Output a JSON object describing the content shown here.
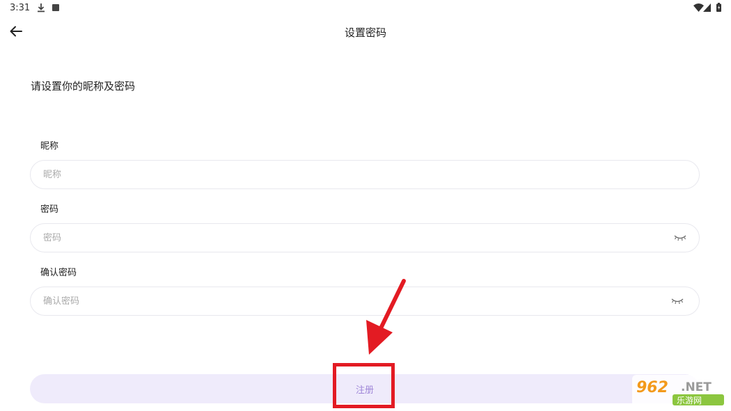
{
  "status_bar": {
    "time": "3:31",
    "icons": [
      "download-icon",
      "app-notification-icon",
      "wifi-icon",
      "signal-icon",
      "battery-icon"
    ]
  },
  "app_bar": {
    "title": "设置密码",
    "back_icon": "arrow-left-icon"
  },
  "intro": "请设置你的昵称及密码",
  "form": {
    "nickname": {
      "label": "昵称",
      "placeholder": "昵称",
      "value": ""
    },
    "password": {
      "label": "密码",
      "placeholder": "密码",
      "value": "",
      "toggle_icon": "eye-closed-icon"
    },
    "confirm_password": {
      "label": "确认密码",
      "placeholder": "确认密码",
      "value": "",
      "toggle_icon": "eye-closed-icon"
    },
    "submit_label": "注册"
  },
  "colors": {
    "button_bg": "#efebfb",
    "button_text": "#9f86d8",
    "annotation_red": "#e31b23",
    "field_border": "#e8e8ee"
  },
  "watermark": {
    "number": "962",
    "suffix": ".NET",
    "subtitle": "乐游网"
  }
}
